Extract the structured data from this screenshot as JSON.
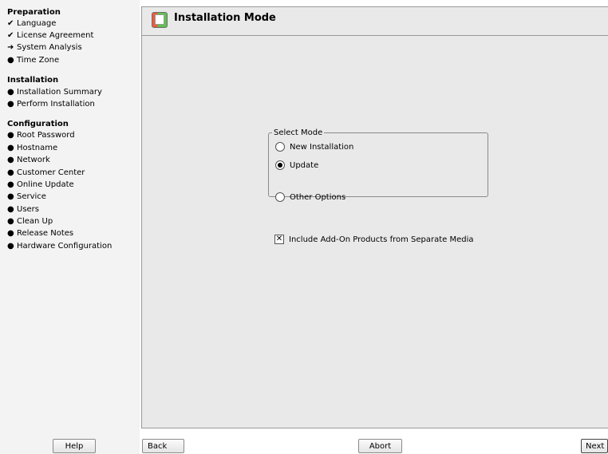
{
  "sidebar": {
    "sections": [
      {
        "title": "Preparation",
        "steps": [
          {
            "label": "Language",
            "mark": "✔"
          },
          {
            "label": "License Agreement",
            "mark": "✔"
          },
          {
            "label": "System Analysis",
            "mark": "➜"
          },
          {
            "label": "Time Zone",
            "mark": "●"
          }
        ]
      },
      {
        "title": "Installation",
        "steps": [
          {
            "label": "Installation Summary",
            "mark": "●"
          },
          {
            "label": "Perform Installation",
            "mark": "●"
          }
        ]
      },
      {
        "title": "Configuration",
        "steps": [
          {
            "label": "Root Password",
            "mark": "●"
          },
          {
            "label": "Hostname",
            "mark": "●"
          },
          {
            "label": "Network",
            "mark": "●"
          },
          {
            "label": "Customer Center",
            "mark": "●"
          },
          {
            "label": "Online Update",
            "mark": "●"
          },
          {
            "label": "Service",
            "mark": "●"
          },
          {
            "label": "Users",
            "mark": "●"
          },
          {
            "label": "Clean Up",
            "mark": "●"
          },
          {
            "label": "Release Notes",
            "mark": "●"
          },
          {
            "label": "Hardware Configuration",
            "mark": "●"
          }
        ]
      }
    ]
  },
  "main": {
    "title": "Installation Mode",
    "mode_group": {
      "legend": "Select Mode",
      "options": [
        {
          "label": "New Installation",
          "selected": false
        },
        {
          "label": "Update",
          "selected": true
        },
        {
          "label": "Other Options",
          "selected": false
        }
      ]
    },
    "addon_checkbox": {
      "label": "Include Add-On Products from Separate Media",
      "checked": true
    }
  },
  "buttons": {
    "help": "Help",
    "back": "Back",
    "abort": "Abort",
    "next": "Next"
  }
}
